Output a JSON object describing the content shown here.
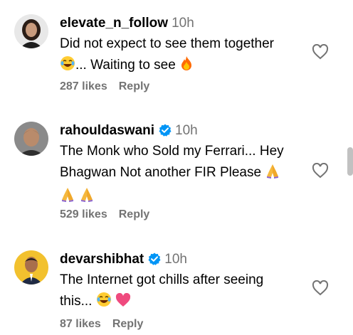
{
  "comments": [
    {
      "username": "elevate_n_follow",
      "time": "10h",
      "verified": false,
      "line1": "Did not expect to see them together",
      "line2": "... Waiting to see",
      "likes": "287 likes",
      "reply": "Reply"
    },
    {
      "username": "rahouldaswani",
      "time": "10h",
      "verified": true,
      "line1": "The Monk who Sold my Ferrari... Hey",
      "line2": "Bhagwan Not another FIR Please",
      "likes": "529 likes",
      "reply": "Reply"
    },
    {
      "username": "devarshibhat",
      "time": "10h",
      "verified": true,
      "line1": "The Internet got chills after seeing",
      "line2": "this...",
      "likes": "87 likes",
      "reply": "Reply"
    }
  ],
  "colors": {
    "verified": "#0095f6",
    "secondary_text": "#737373"
  }
}
